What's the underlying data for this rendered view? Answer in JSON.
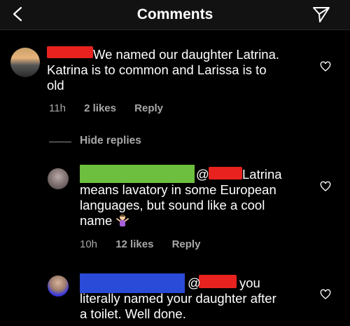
{
  "header": {
    "title": "Comments"
  },
  "comments": [
    {
      "text_line1": "We named our daughter Latrina.",
      "text_line2": "Katrina is to common and Larissa is to",
      "text_line3": "old",
      "time": "11h",
      "likes": "2 likes",
      "reply": "Reply"
    }
  ],
  "hide_replies": "Hide replies",
  "replies": [
    {
      "mention_at": "@",
      "text_line1_end": "Latrina",
      "text_line2": "means lavatory in some European",
      "text_line3": "languages, but sound like a cool",
      "text_line4": "name",
      "time": "10h",
      "likes": "12 likes",
      "reply": "Reply"
    },
    {
      "mention_at": "@",
      "text_line1_end": "you",
      "text_line2": "literally named your daughter after",
      "text_line3": "a toilet. Well done."
    }
  ],
  "icons": {
    "back": "chevron-left-icon",
    "send": "paper-plane-icon",
    "like": "heart-icon",
    "emoji": "person-shrugging-emoji"
  }
}
